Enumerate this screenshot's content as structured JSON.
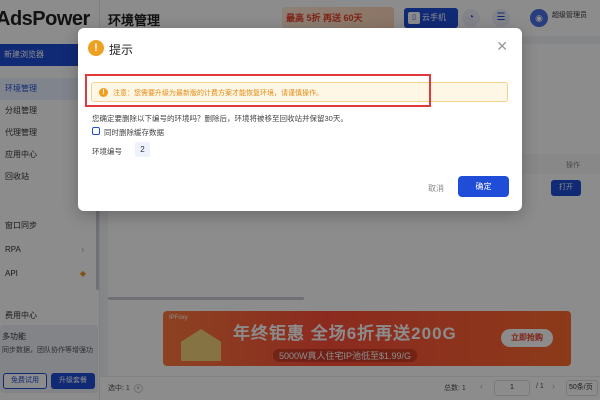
{
  "app": {
    "logo": "AdsPower"
  },
  "sidebar": {
    "new_browser": "新建浏览器",
    "new_browser_icon": "plus-icon",
    "items": [
      {
        "label": "环境管理",
        "active": true
      },
      {
        "label": "分组管理"
      },
      {
        "label": "代理管理"
      },
      {
        "label": "应用中心"
      },
      {
        "label": "回收站"
      }
    ],
    "items2": [
      {
        "label": "窗口同步"
      },
      {
        "label": "RPA"
      },
      {
        "label": "API"
      },
      {
        "label": "费用中心"
      }
    ],
    "promo": {
      "title": "多功能",
      "desc": "同步数据，团队协作等增强功",
      "trial": "免费试用",
      "upgrade": "升级套餐"
    }
  },
  "header": {
    "title": "环境管理",
    "ad": "最高 5折 再送 60天",
    "phone": "云手机",
    "user_name": "超级管理员"
  },
  "table": {
    "op_header": "操作",
    "open_btn": "打开"
  },
  "bottom_ad": {
    "tag": "IPFoxy",
    "line1": "年终钜惠 全场6折再送200G",
    "line2": "5000W真人住宅IP池低至$1.99/G",
    "cta": "立即抢购"
  },
  "footer": {
    "selected_label": "选中: 1",
    "total": "总数: 1",
    "page": "1",
    "page_total": "/ 1",
    "page_size": "50条/页"
  },
  "modal": {
    "title": "提示",
    "warning": "注意：您需要升级为最新版的计费方案才能恢复环境，请谨慎操作。",
    "confirm_text": "您确定要删除以下编号的环境吗？删除后，环境将被移至回收站并保留30天。",
    "checkbox_label": "同时删除缓存数据",
    "checkbox_checked": false,
    "env_label": "环境编号",
    "env_number": "2",
    "cancel": "取消",
    "ok": "确定"
  },
  "colors": {
    "primary": "#1f4dd8",
    "warning": "#f0a020",
    "highlight": "#e23a3a"
  }
}
